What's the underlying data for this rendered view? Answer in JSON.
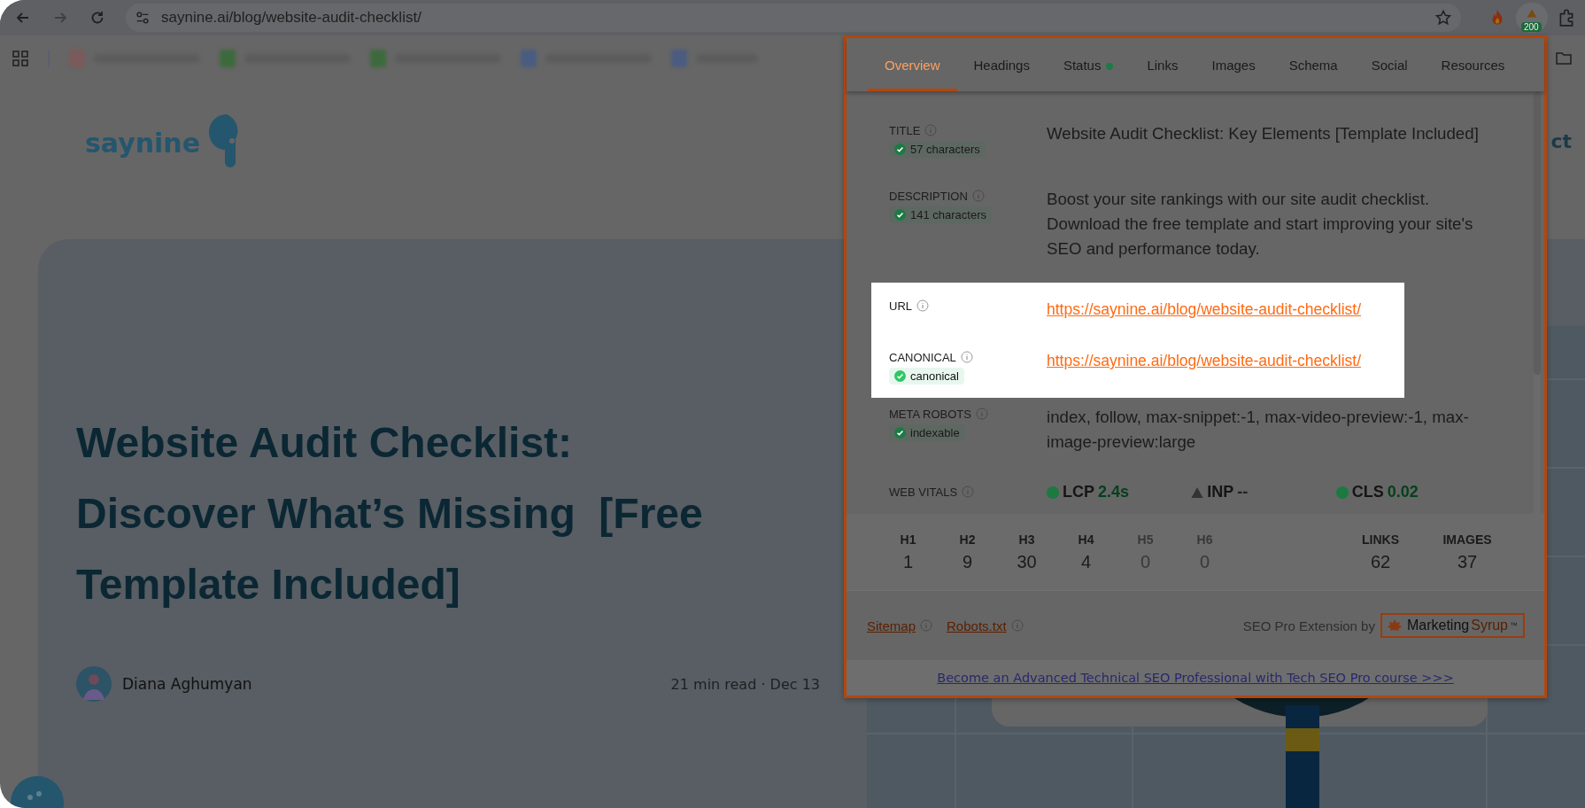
{
  "browser": {
    "url": "saynine.ai/blog/website-audit-checklist/",
    "extension_badge": "200"
  },
  "page": {
    "logo": "saynine",
    "nav_fragment": "ct",
    "headline_lines": [
      "Website Audit Checklist:",
      "Discover What’s Missing  [Free",
      "Template Included]"
    ],
    "author": "Diana Aghumyan",
    "meta": "21 min read · Dec 13"
  },
  "panel": {
    "tabs": [
      {
        "label": "Overview",
        "selected": true,
        "dot": false
      },
      {
        "label": "Headings",
        "selected": false,
        "dot": false
      },
      {
        "label": "Status",
        "selected": false,
        "dot": true
      },
      {
        "label": "Links",
        "selected": false,
        "dot": false
      },
      {
        "label": "Images",
        "selected": false,
        "dot": false
      },
      {
        "label": "Schema",
        "selected": false,
        "dot": false
      },
      {
        "label": "Social",
        "selected": false,
        "dot": false
      },
      {
        "label": "Resources",
        "selected": false,
        "dot": false
      }
    ],
    "rows": [
      {
        "label": "TITLE",
        "badge": "57 characters",
        "kind": "text",
        "highlighted": false,
        "value": "Website Audit Checklist: Key Elements [Template Included]"
      },
      {
        "label": "DESCRIPTION",
        "badge": "141 characters",
        "kind": "text",
        "highlighted": false,
        "value": "Boost your site rankings with our site audit checklist. Download the free template and start improving your site's SEO and performance today."
      },
      {
        "label": "URL",
        "kind": "link",
        "highlighted": true,
        "value": "https://saynine.ai/blog/website-audit-checklist/"
      },
      {
        "label": "CANONICAL",
        "badge": "canonical",
        "kind": "link",
        "highlighted": true,
        "value": "https://saynine.ai/blog/website-audit-checklist/"
      },
      {
        "label": "META ROBOTS",
        "badge": "indexable",
        "kind": "text",
        "highlighted": false,
        "value": "index, follow, max-snippet:-1, max-video-preview:-1, max-image-preview:large"
      },
      {
        "label": "WEB VITALS",
        "kind": "vitals",
        "highlighted": false,
        "vitals": [
          {
            "name": "LCP",
            "value": "2.4s",
            "good": true
          },
          {
            "name": "INP",
            "value": "--",
            "good": false
          },
          {
            "name": "CLS",
            "value": "0.02",
            "good": true
          }
        ]
      }
    ],
    "headings": [
      {
        "label": "H1",
        "value": "1",
        "muted": false
      },
      {
        "label": "H2",
        "value": "9",
        "muted": false
      },
      {
        "label": "H3",
        "value": "30",
        "muted": false
      },
      {
        "label": "H4",
        "value": "4",
        "muted": false
      },
      {
        "label": "H5",
        "value": "0",
        "muted": true
      },
      {
        "label": "H6",
        "value": "0",
        "muted": true
      }
    ],
    "totals": [
      {
        "label": "LINKS",
        "value": "62"
      },
      {
        "label": "IMAGES",
        "value": "37"
      }
    ],
    "footer_links": [
      "Sitemap",
      "Robots.txt"
    ],
    "credit": "SEO Pro Extension by",
    "brand": {
      "first": "Marketing",
      "second": "Syrup",
      "mark": "™"
    },
    "promo_link": "Become an Advanced Technical SEO Professional with Tech SEO Pro course >>>"
  }
}
